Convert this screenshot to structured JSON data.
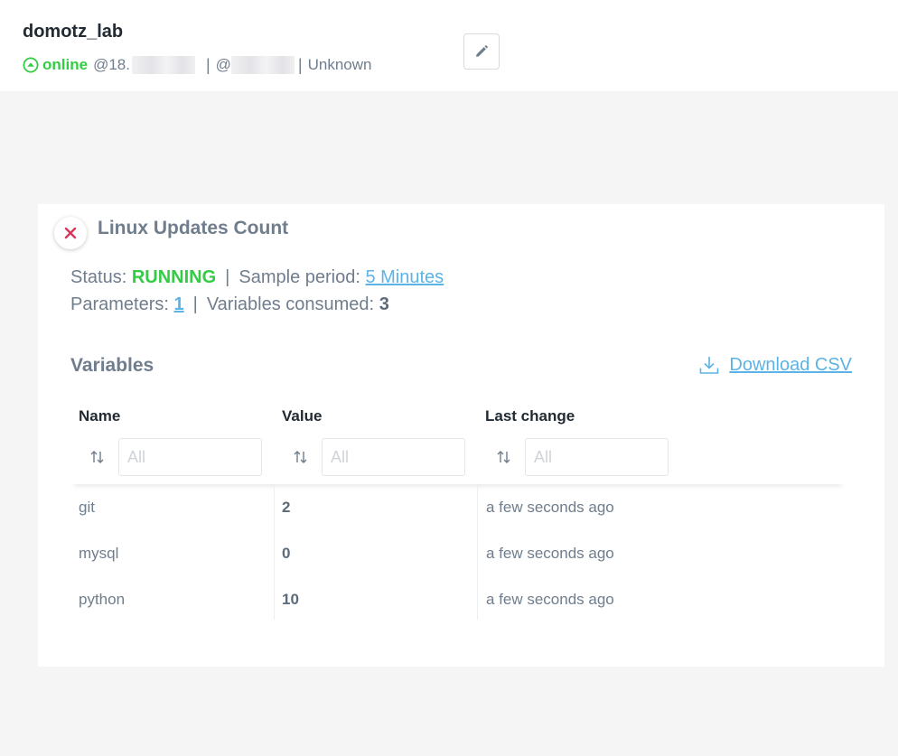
{
  "device": {
    "name": "domotz_lab",
    "status": "online",
    "ip_prefix": "@18.",
    "mac_prefix": "@",
    "vendor": "Unknown",
    "separator": "|"
  },
  "panel": {
    "title": "Linux Updates Count",
    "status_label": "Status:",
    "status_value": "RUNNING",
    "sample_period_label": "Sample period:",
    "sample_period_value": "5 Minutes",
    "parameters_label": "Parameters:",
    "parameters_value": "1",
    "variables_consumed_label": "Variables consumed:",
    "variables_consumed_value": "3",
    "separator": "|"
  },
  "variables": {
    "heading": "Variables",
    "download_label": "Download CSV",
    "columns": [
      {
        "label": "Name",
        "filter_placeholder": "All"
      },
      {
        "label": "Value",
        "filter_placeholder": "All"
      },
      {
        "label": "Last change",
        "filter_placeholder": "All"
      }
    ],
    "rows": [
      {
        "name": "git",
        "value": "2",
        "last_change": "a few seconds ago"
      },
      {
        "name": "mysql",
        "value": "0",
        "last_change": "a few seconds ago"
      },
      {
        "name": "python",
        "value": "10",
        "last_change": "a few seconds ago"
      }
    ]
  },
  "colors": {
    "online_green": "#33cc44",
    "link_blue": "#5bb4e5",
    "close_red": "#d6365c",
    "muted_text": "#6f7d8c"
  },
  "icons": {
    "status": "online-arrow-up-circle-icon",
    "edit": "pencil-icon",
    "close": "close-icon",
    "download": "download-icon",
    "sort": "sort-arrows-icon"
  }
}
